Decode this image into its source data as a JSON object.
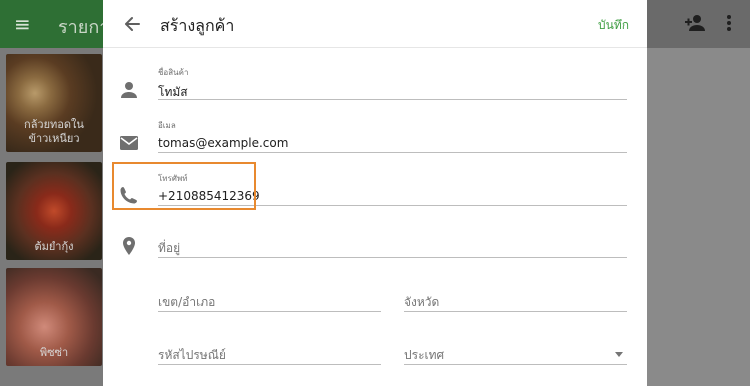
{
  "background": {
    "app_title": "รายการ",
    "cards": [
      {
        "caption": "กล้วยทอดใน\nข้าวเหนียว"
      },
      {
        "caption": "ต้มยำกุ้ง"
      },
      {
        "caption": "พิซซ่า"
      }
    ],
    "icons": [
      "menu-icon",
      "add-person-icon",
      "more-vert-icon"
    ]
  },
  "dialog": {
    "title": "สร้างลูกค้า",
    "save_label": "บันทึก",
    "fields": {
      "name": {
        "label": "ชื่อสินค้า",
        "value": "โทมัส"
      },
      "email": {
        "label": "อีเมล",
        "value": "tomas@example.com"
      },
      "phone": {
        "label": "โทรศัพท์",
        "value": "+210885412369"
      },
      "address": {
        "placeholder": "ที่อยู่"
      },
      "district": {
        "placeholder": "เขต/อำเภอ"
      },
      "province": {
        "placeholder": "จังหวัด"
      },
      "postal_code": {
        "placeholder": "รหัสไปรษณีย์"
      },
      "country": {
        "placeholder": "ประเทศ"
      }
    }
  },
  "colors": {
    "accent": "#43a047",
    "appbar": "#2e6f34",
    "highlight": "#e8892f"
  }
}
